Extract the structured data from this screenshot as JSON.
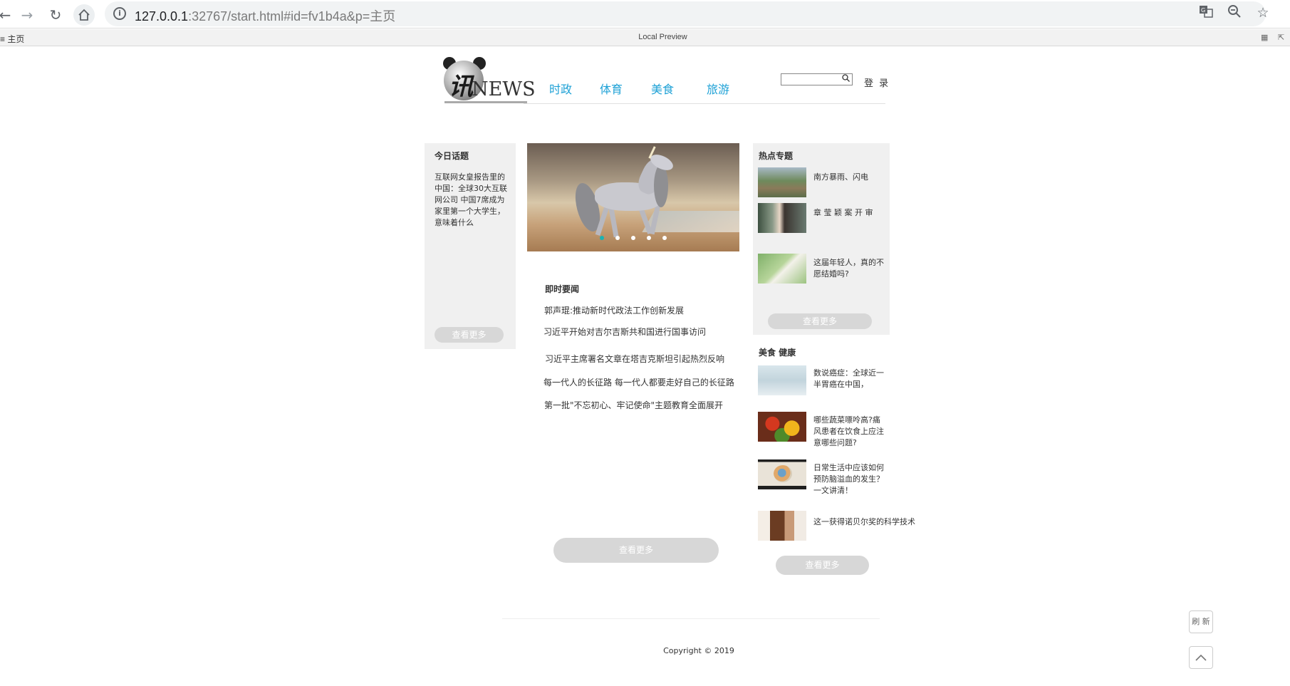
{
  "browser": {
    "url_host": "127.0.0.1",
    "url_rest": ":32767/start.html#id=fv1b4a&p=主页",
    "back_icon": "arrow-left",
    "forward_icon": "arrow-right",
    "reload_icon": "reload",
    "home_icon": "home",
    "translate_icon": "translate",
    "zoom_icon": "zoom-out",
    "bookmark_icon": "star"
  },
  "preview": {
    "crumb": "主页",
    "title": "Local Preview"
  },
  "header": {
    "logo_char": "讯",
    "logo_text": "NEWS",
    "nav": [
      "时政",
      "体育",
      "美食",
      "旅游"
    ],
    "login": "登 录"
  },
  "today": {
    "title": "今日话题",
    "text": "互联网女皇报告里的中国：全球30大互联网公司 中国7席成为家里第一个大学生，意味着什么",
    "more": "查看更多"
  },
  "carousel": {
    "slide_count": 5,
    "active_index": 0
  },
  "breaking": {
    "title": "即时要闻",
    "items": [
      "郭声琨:推动新时代政法工作创新发展",
      "习近平开始对吉尔吉斯共和国进行国事访问",
      "习近平主席署名文章在塔吉克斯坦引起热烈反响",
      "每一代人的长征路 每一代人都要走好自己的长征路",
      "第一批\"不忘初心、牢记使命\"主题教育全面展开"
    ],
    "more": "查看更多"
  },
  "hot": {
    "title": "热点专题",
    "items": [
      {
        "text": "南方暴雨、闪电"
      },
      {
        "text": "章 莹 颖 案 开 审"
      },
      {
        "text": "这届年轻人，真的不愿结婚吗?"
      }
    ],
    "more": "查看更多"
  },
  "health": {
    "title": "美食  健康",
    "items": [
      {
        "text": "数说癌症：全球近一半胃癌在中国，"
      },
      {
        "text": "哪些蔬菜嘌呤高?痛风患者在饮食上应注意哪些问题?"
      },
      {
        "text": "日常生活中应该如何预防脑溢血的发生？一文讲清！"
      },
      {
        "text": "这一获得诺贝尔奖的科学技术"
      }
    ],
    "more": "查看更多"
  },
  "footer": {
    "copyright": "Copyright © 2019"
  },
  "side": {
    "refresh": "刷 新",
    "top_icon": "chevron-up"
  }
}
